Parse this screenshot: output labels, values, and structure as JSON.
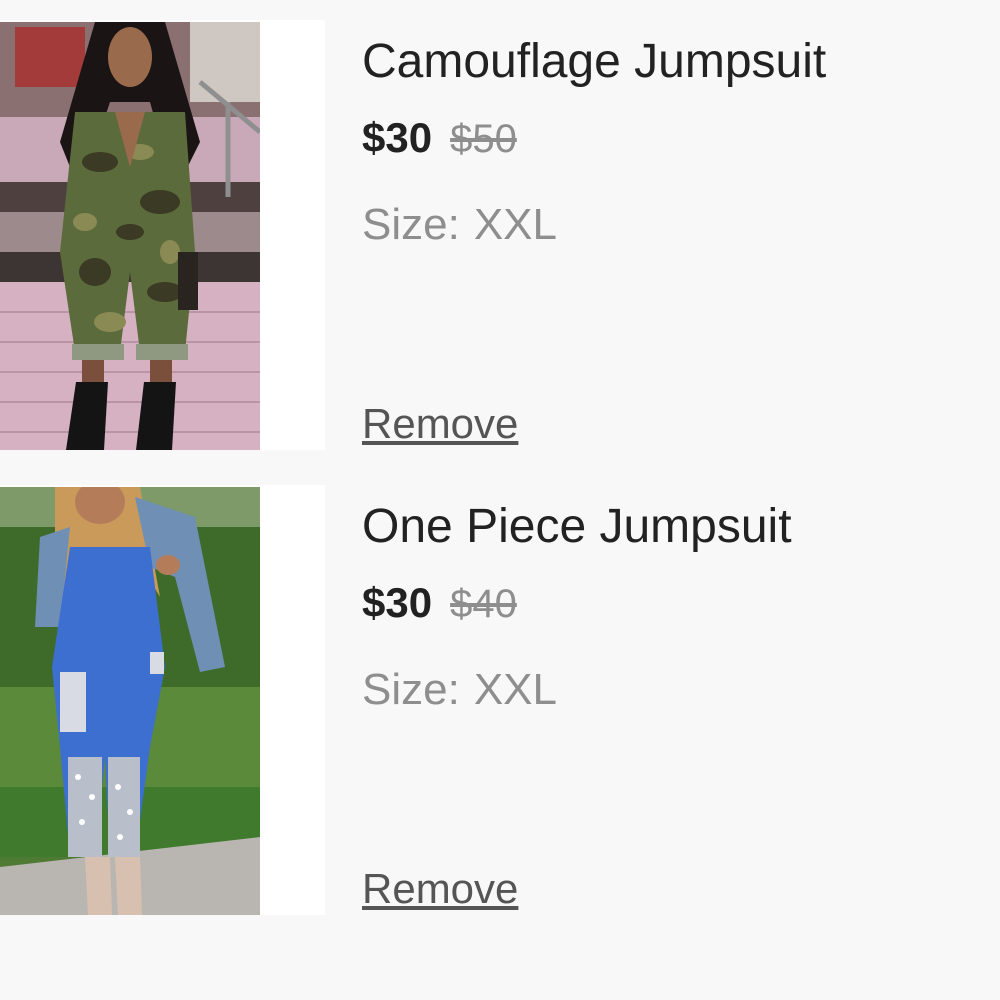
{
  "cart": {
    "items": [
      {
        "title": "Camouflage Jumpsuit",
        "price": "$30",
        "old_price": "$50",
        "size_label": "Size:",
        "size_value": "XXL",
        "remove_label": "Remove"
      },
      {
        "title": "One Piece Jumpsuit",
        "price": "$30",
        "old_price": "$40",
        "size_label": "Size:",
        "size_value": "XXL",
        "remove_label": "Remove"
      }
    ]
  },
  "colors": {
    "background": "#f8f8f8",
    "card": "#ffffff",
    "text_primary": "#222222",
    "text_muted": "#8e8e8e"
  }
}
